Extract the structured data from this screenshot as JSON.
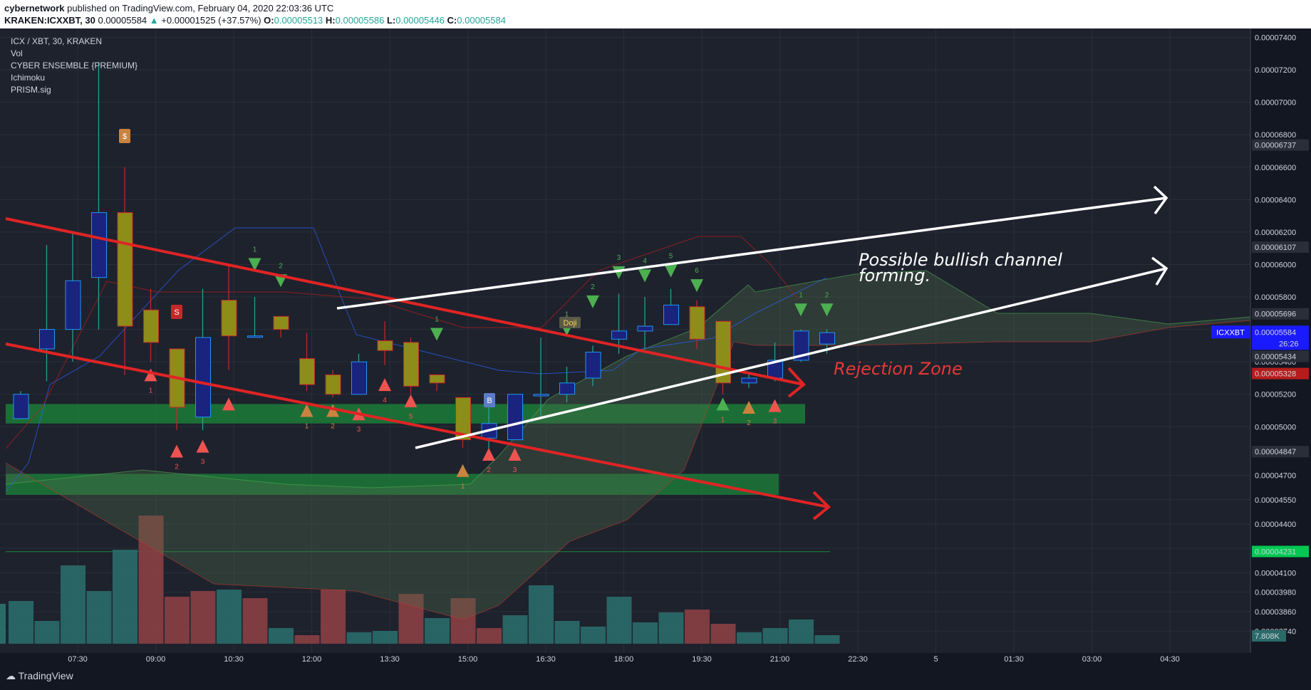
{
  "header": {
    "author": "cybernetwork",
    "published": "published on TradingView.com, February 04, 2020 22:03:36 UTC",
    "symbol_line": "KRAKEN:ICXXBT, 30",
    "last": "0.00005584",
    "change_arrow": "▲",
    "change": "+0.00001525 (+37.57%)",
    "o_label": "O:",
    "o_val": "0.00005513",
    "h_label": "H:",
    "h_val": "0.00005586",
    "l_label": "L:",
    "l_val": "0.00005446",
    "c_label": "C:",
    "c_val": "0.00005584"
  },
  "legend": [
    "ICX / XBT, 30, KRAKEN",
    "Vol",
    "CYBER ENSEMBLE {PREMIUM}",
    "Ichimoku",
    "PRISM.sig"
  ],
  "footer": {
    "brand": "TradingView"
  },
  "chart_data": {
    "type": "candlestick",
    "ylim": [
      3.68e-05,
      7.42e-05
    ],
    "y_ticks": [
      "0.00007400",
      "0.00007200",
      "0.00007000",
      "0.00006800",
      "0.00006600",
      "0.00006400",
      "0.00006200",
      "0.00006000",
      "0.00005800",
      "0.00005600",
      "0.00005400",
      "0.00005200",
      "0.00005000",
      "0.00004700",
      "0.00004550",
      "0.00004400",
      "0.00004250",
      "0.00004100",
      "0.00003980",
      "0.00003860",
      "0.00003740"
    ],
    "x_ticks": [
      "07:30",
      "09:00",
      "10:30",
      "12:00",
      "13:30",
      "15:00",
      "16:30",
      "18:00",
      "19:30",
      "21:00",
      "22:30",
      "5",
      "01:30",
      "03:00",
      "04:30"
    ],
    "price_labels": [
      {
        "text": "0.00006737",
        "value": 6.737e-05,
        "color": "#2a2e39"
      },
      {
        "text": "0.00006107",
        "value": 6.107e-05,
        "color": "#2a2e39"
      },
      {
        "text": "0.00005696",
        "value": 5.696e-05,
        "color": "#2a2e39"
      },
      {
        "text": "0.00005434",
        "value": 5.434e-05,
        "color": "#2a2e39"
      },
      {
        "text": "0.00005328",
        "value": 5.328e-05,
        "color": "#b71c1c"
      },
      {
        "text": "0.00004847",
        "value": 4.847e-05,
        "color": "#2a2e39"
      },
      {
        "text": "0.00004231",
        "value": 4.231e-05,
        "color": "#00c853"
      }
    ],
    "last_price": {
      "symbol": "ICXXBT",
      "value": "0.00005584",
      "countdown": "26:26"
    },
    "volume_label": "7.808K",
    "candles": [
      {
        "o": 5.05e-05,
        "h": 5.22e-05,
        "l": 5.05e-05,
        "c": 5.2e-05
      },
      {
        "o": 5.48e-05,
        "h": 6.12e-05,
        "l": 5.28e-05,
        "c": 5.6e-05
      },
      {
        "o": 5.6e-05,
        "h": 6.2e-05,
        "l": 5.4e-05,
        "c": 5.9e-05
      },
      {
        "o": 5.92e-05,
        "h": 7.25e-05,
        "l": 5.6e-05,
        "c": 6.32e-05
      },
      {
        "o": 6.32e-05,
        "h": 6.6e-05,
        "l": 5.32e-05,
        "c": 5.62e-05
      },
      {
        "o": 5.72e-05,
        "h": 5.85e-05,
        "l": 5.4e-05,
        "c": 5.52e-05
      },
      {
        "o": 5.48e-05,
        "h": 5.48e-05,
        "l": 4.98e-05,
        "c": 5.12e-05
      },
      {
        "o": 5.06e-05,
        "h": 5.85e-05,
        "l": 4.98e-05,
        "c": 5.55e-05
      },
      {
        "o": 5.78e-05,
        "h": 6e-05,
        "l": 5.35e-05,
        "c": 5.56e-05
      },
      {
        "o": 5.56e-05,
        "h": 5.8e-05,
        "l": 5.56e-05,
        "c": 5.56e-05
      },
      {
        "o": 5.68e-05,
        "h": 5.68e-05,
        "l": 5.55e-05,
        "c": 5.6e-05
      },
      {
        "o": 5.42e-05,
        "h": 5.58e-05,
        "l": 5.22e-05,
        "c": 5.26e-05
      },
      {
        "o": 5.32e-05,
        "h": 5.35e-05,
        "l": 5.18e-05,
        "c": 5.2e-05
      },
      {
        "o": 5.2e-05,
        "h": 5.45e-05,
        "l": 5.2e-05,
        "c": 5.4e-05
      },
      {
        "o": 5.53e-05,
        "h": 5.65e-05,
        "l": 5.38e-05,
        "c": 5.47e-05
      },
      {
        "o": 5.52e-05,
        "h": 5.55e-05,
        "l": 5.2e-05,
        "c": 5.25e-05
      },
      {
        "o": 5.32e-05,
        "h": 5.32e-05,
        "l": 5.22e-05,
        "c": 5.27e-05
      },
      {
        "o": 5.18e-05,
        "h": 5.18e-05,
        "l": 4.87e-05,
        "c": 4.92e-05
      },
      {
        "o": 4.93e-05,
        "h": 5.18e-05,
        "l": 4.85e-05,
        "c": 5.02e-05
      },
      {
        "o": 4.92e-05,
        "h": 5.2e-05,
        "l": 4.92e-05,
        "c": 5.2e-05
      },
      {
        "o": 5.19e-05,
        "h": 5.55e-05,
        "l": 5.05e-05,
        "c": 5.2e-05
      },
      {
        "o": 5.2e-05,
        "h": 5.37e-05,
        "l": 5.15e-05,
        "c": 5.27e-05
      },
      {
        "o": 5.3e-05,
        "h": 5.5e-05,
        "l": 5.25e-05,
        "c": 5.46e-05
      },
      {
        "o": 5.54e-05,
        "h": 5.82e-05,
        "l": 5.45e-05,
        "c": 5.59e-05
      },
      {
        "o": 5.59e-05,
        "h": 5.8e-05,
        "l": 5.48e-05,
        "c": 5.62e-05
      },
      {
        "o": 5.63e-05,
        "h": 5.85e-05,
        "l": 5.63e-05,
        "c": 5.75e-05
      },
      {
        "o": 5.74e-05,
        "h": 5.78e-05,
        "l": 5.48e-05,
        "c": 5.54e-05
      },
      {
        "o": 5.65e-05,
        "h": 5.65e-05,
        "l": 5.2e-05,
        "c": 5.27e-05
      },
      {
        "o": 5.27e-05,
        "h": 5.33e-05,
        "l": 5.24e-05,
        "c": 5.3e-05
      },
      {
        "o": 5.3e-05,
        "h": 5.52e-05,
        "l": 5.28e-05,
        "c": 5.41e-05
      },
      {
        "o": 5.41e-05,
        "h": 5.6e-05,
        "l": 5.4e-05,
        "c": 5.59e-05
      },
      {
        "o": 5.51e-05,
        "h": 5.6e-05,
        "l": 5.45e-05,
        "c": 5.58e-05
      }
    ],
    "volume": [
      {
        "v": 3.0,
        "up": true
      },
      {
        "v": 1.6,
        "up": true
      },
      {
        "v": 5.5,
        "up": true
      },
      {
        "v": 3.7,
        "up": true
      },
      {
        "v": 6.6,
        "up": true
      },
      {
        "v": 9.0,
        "up": false
      },
      {
        "v": 3.3,
        "up": false
      },
      {
        "v": 3.7,
        "up": false
      },
      {
        "v": 3.8,
        "up": true
      },
      {
        "v": 3.2,
        "up": false
      },
      {
        "v": 1.1,
        "up": true
      },
      {
        "v": 0.6,
        "up": false
      },
      {
        "v": 3.8,
        "up": false
      },
      {
        "v": 0.8,
        "up": true
      },
      {
        "v": 0.9,
        "up": true
      },
      {
        "v": 3.5,
        "up": false
      },
      {
        "v": 1.8,
        "up": true
      },
      {
        "v": 3.2,
        "up": false
      },
      {
        "v": 1.1,
        "up": false
      },
      {
        "v": 2.0,
        "up": true
      },
      {
        "v": 4.1,
        "up": true
      },
      {
        "v": 1.6,
        "up": true
      },
      {
        "v": 1.2,
        "up": true
      },
      {
        "v": 3.3,
        "up": true
      },
      {
        "v": 1.5,
        "up": true
      },
      {
        "v": 2.2,
        "up": true
      },
      {
        "v": 2.4,
        "up": false
      },
      {
        "v": 1.4,
        "up": false
      },
      {
        "v": 0.8,
        "up": true
      },
      {
        "v": 1.1,
        "up": true
      },
      {
        "v": 1.7,
        "up": true
      },
      {
        "v": 0.6,
        "up": true
      }
    ],
    "annotations": {
      "channel_text_1": "Possible bullish channel",
      "channel_text_2": "forming.",
      "rejection_text": "Rejection Zone",
      "doji": "Doji",
      "sell_badge": "S",
      "buy_badge": "B",
      "dollar_badge": "$"
    },
    "markers": {
      "down_tri": [
        {
          "i": 9,
          "p": 6e-05,
          "n": "1"
        },
        {
          "i": 10,
          "p": 5.9e-05,
          "n": "2"
        },
        {
          "i": 16,
          "p": 5.57e-05,
          "n": "1"
        },
        {
          "i": 21,
          "p": 5.6e-05,
          "n": "1"
        },
        {
          "i": 22,
          "p": 5.77e-05,
          "n": "2"
        },
        {
          "i": 23,
          "p": 5.95e-05,
          "n": "3"
        },
        {
          "i": 24,
          "p": 5.93e-05,
          "n": "4"
        },
        {
          "i": 25,
          "p": 5.96e-05,
          "n": "5"
        },
        {
          "i": 26,
          "p": 5.87e-05,
          "n": "6"
        },
        {
          "i": 30,
          "p": 5.72e-05,
          "n": "1"
        },
        {
          "i": 31,
          "p": 5.72e-05,
          "n": "2"
        }
      ],
      "up_tri_red": [
        {
          "i": 5,
          "p": 5.32e-05,
          "n": "1"
        },
        {
          "i": 6,
          "p": 4.85e-05,
          "n": "2"
        },
        {
          "i": 7,
          "p": 4.88e-05,
          "n": "3"
        },
        {
          "i": 8,
          "p": 5.14e-05,
          "n": ""
        },
        {
          "i": 13,
          "p": 5.08e-05,
          "n": "3"
        },
        {
          "i": 14,
          "p": 5.26e-05,
          "n": "4"
        },
        {
          "i": 15,
          "p": 5.16e-05,
          "n": "5"
        },
        {
          "i": 18,
          "p": 4.83e-05,
          "n": "2"
        },
        {
          "i": 19,
          "p": 4.83e-05,
          "n": "3"
        },
        {
          "i": 29,
          "p": 5.13e-05,
          "n": "3"
        }
      ],
      "up_tri_tan": [
        {
          "i": 11,
          "p": 5.1e-05,
          "n": "1"
        },
        {
          "i": 12,
          "p": 5.1e-05,
          "n": "2"
        },
        {
          "i": 17,
          "p": 4.73e-05,
          "n": "1"
        },
        {
          "i": 28,
          "p": 5.12e-05,
          "n": "2"
        }
      ],
      "up_tri_green": [
        {
          "i": 27,
          "p": 5.14e-05,
          "n": "1"
        }
      ]
    }
  }
}
